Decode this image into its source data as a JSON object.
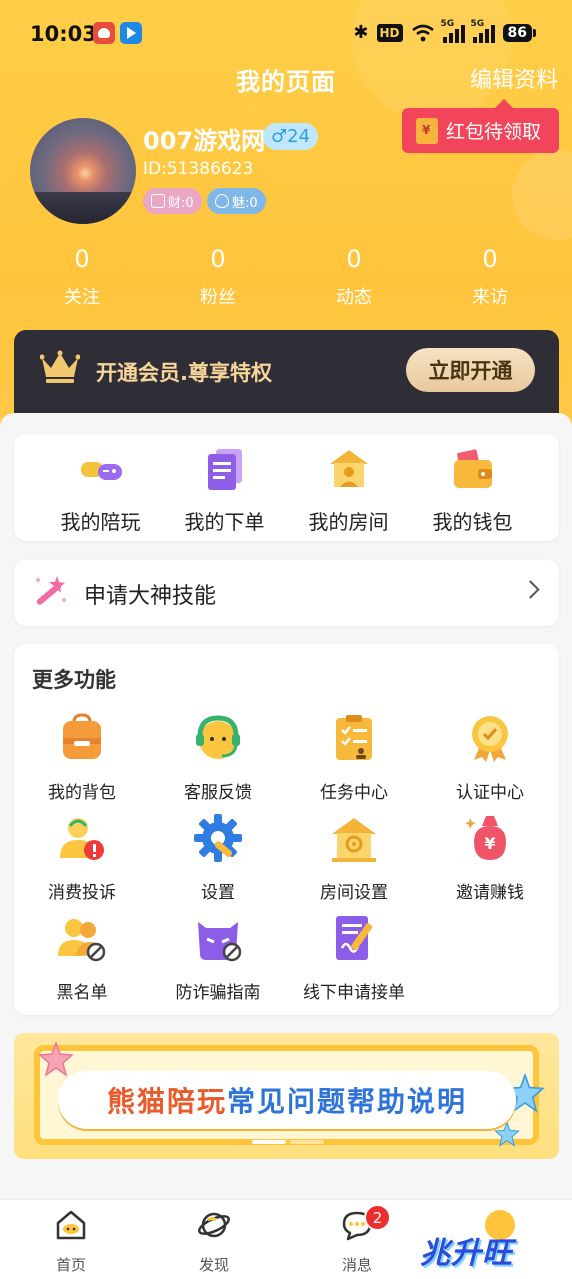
{
  "status_bar": {
    "time": "10:03",
    "hd": "HD",
    "battery": "86",
    "net1": "5G",
    "net2": "5G"
  },
  "header": {
    "title": "我的页面",
    "edit": "编辑资料"
  },
  "redpacket": {
    "label": "红包待领取"
  },
  "profile": {
    "name": "007游戏网",
    "gender_age": "♂24",
    "id": "ID:51386623",
    "wealth": "财:0",
    "charm": "魅:0"
  },
  "stats": [
    {
      "value": "0",
      "label": "关注"
    },
    {
      "value": "0",
      "label": "粉丝"
    },
    {
      "value": "0",
      "label": "动态"
    },
    {
      "value": "0",
      "label": "来访"
    }
  ],
  "vip": {
    "text": "开通会员.尊享特权",
    "button": "立即开通"
  },
  "quick": [
    {
      "label": "我的陪玩",
      "icon": "gamepad-icon"
    },
    {
      "label": "我的下单",
      "icon": "order-icon"
    },
    {
      "label": "我的房间",
      "icon": "room-icon"
    },
    {
      "label": "我的钱包",
      "icon": "wallet-icon"
    }
  ],
  "skill": {
    "label": "申请大神技能"
  },
  "more": {
    "title": "更多功能",
    "items": [
      {
        "label": "我的背包",
        "icon": "backpack-icon"
      },
      {
        "label": "客服反馈",
        "icon": "headset-icon"
      },
      {
        "label": "任务中心",
        "icon": "task-icon"
      },
      {
        "label": "认证中心",
        "icon": "certificate-icon"
      },
      {
        "label": "消费投诉",
        "icon": "complaint-icon"
      },
      {
        "label": "设置",
        "icon": "gear-icon"
      },
      {
        "label": "房间设置",
        "icon": "room-settings-icon"
      },
      {
        "label": "邀请赚钱",
        "icon": "money-bag-icon"
      },
      {
        "label": "黑名单",
        "icon": "blacklist-icon"
      },
      {
        "label": "防诈骗指南",
        "icon": "anti-fraud-icon"
      },
      {
        "label": "线下申请接单",
        "icon": "apply-form-icon"
      }
    ]
  },
  "banner": {
    "part1": "熊猫陪玩",
    "part2": "常见问题帮助说明"
  },
  "tabs": [
    {
      "label": "首页",
      "icon": "home-icon"
    },
    {
      "label": "发现",
      "icon": "discover-icon"
    },
    {
      "label": "消息",
      "icon": "message-icon"
    },
    {
      "label": "",
      "icon": "profile-icon"
    }
  ],
  "message_badge": "2",
  "watermark": "兆升旺",
  "colors": {
    "primary": "#ffc43c",
    "vip_bg": "#2f2d36",
    "red": "#f2455c"
  }
}
